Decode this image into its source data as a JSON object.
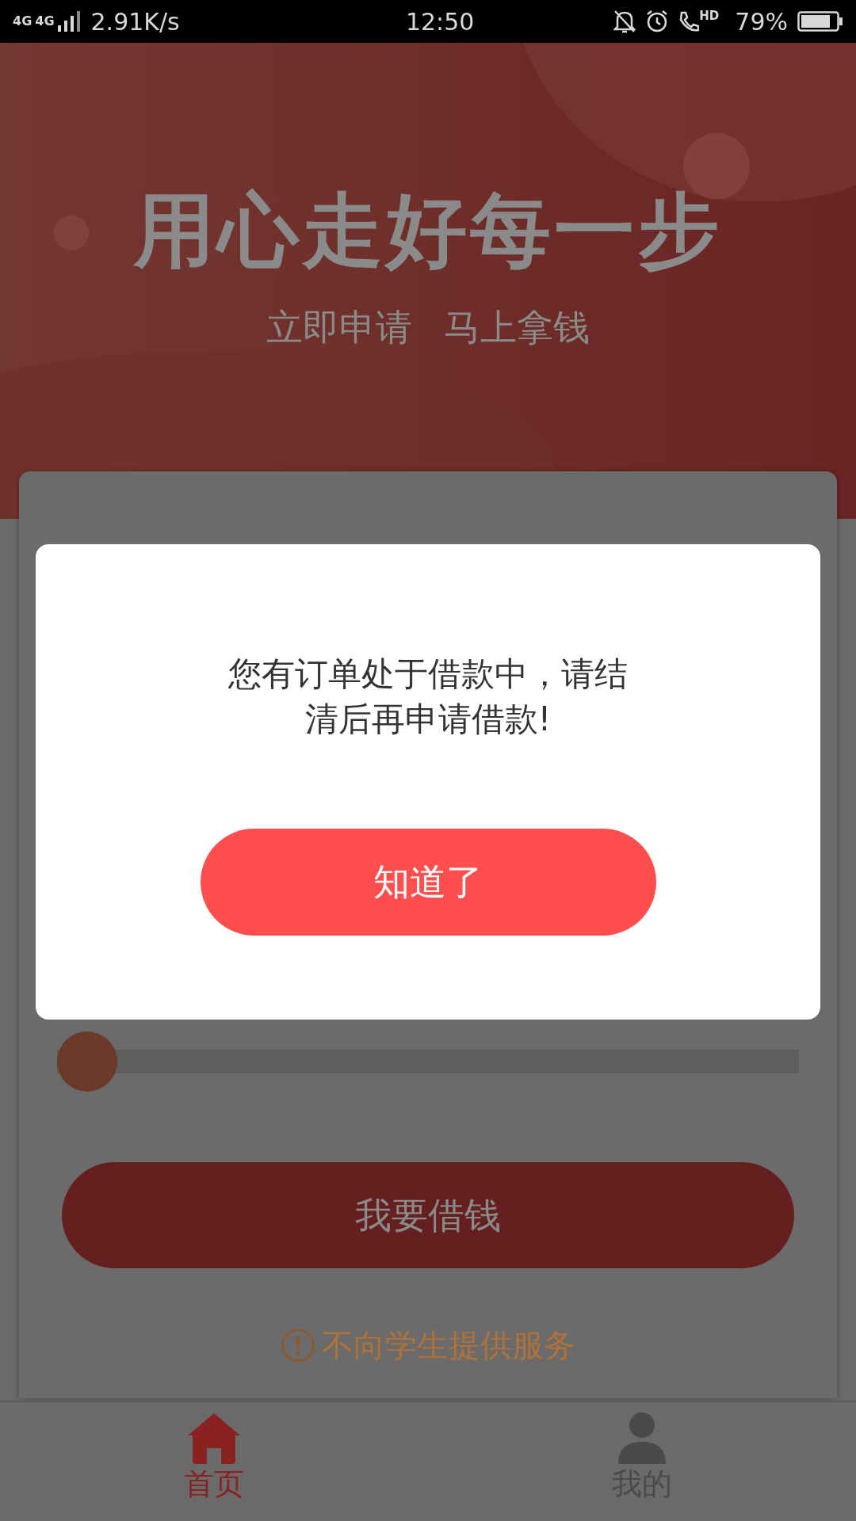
{
  "status_bar": {
    "network": [
      "4G",
      "4G"
    ],
    "speed": "2.91K/s",
    "time": "12:50",
    "call_label": "HD",
    "battery": "79%"
  },
  "banner": {
    "title": "用心走好每一步",
    "subtitle": [
      "立即申请",
      "马上拿钱"
    ]
  },
  "card": {
    "slider": {
      "level": 0
    },
    "button": "我要借钱",
    "notice": "不向学生提供服务"
  },
  "dialog": {
    "message": "您有订单处于借款中，请结清后再申请借款!",
    "button": "知道了"
  },
  "tabs": [
    {
      "label": "首页",
      "selected": true,
      "kind": "home"
    },
    {
      "label": "我的",
      "selected": false,
      "kind": "profile"
    }
  ]
}
